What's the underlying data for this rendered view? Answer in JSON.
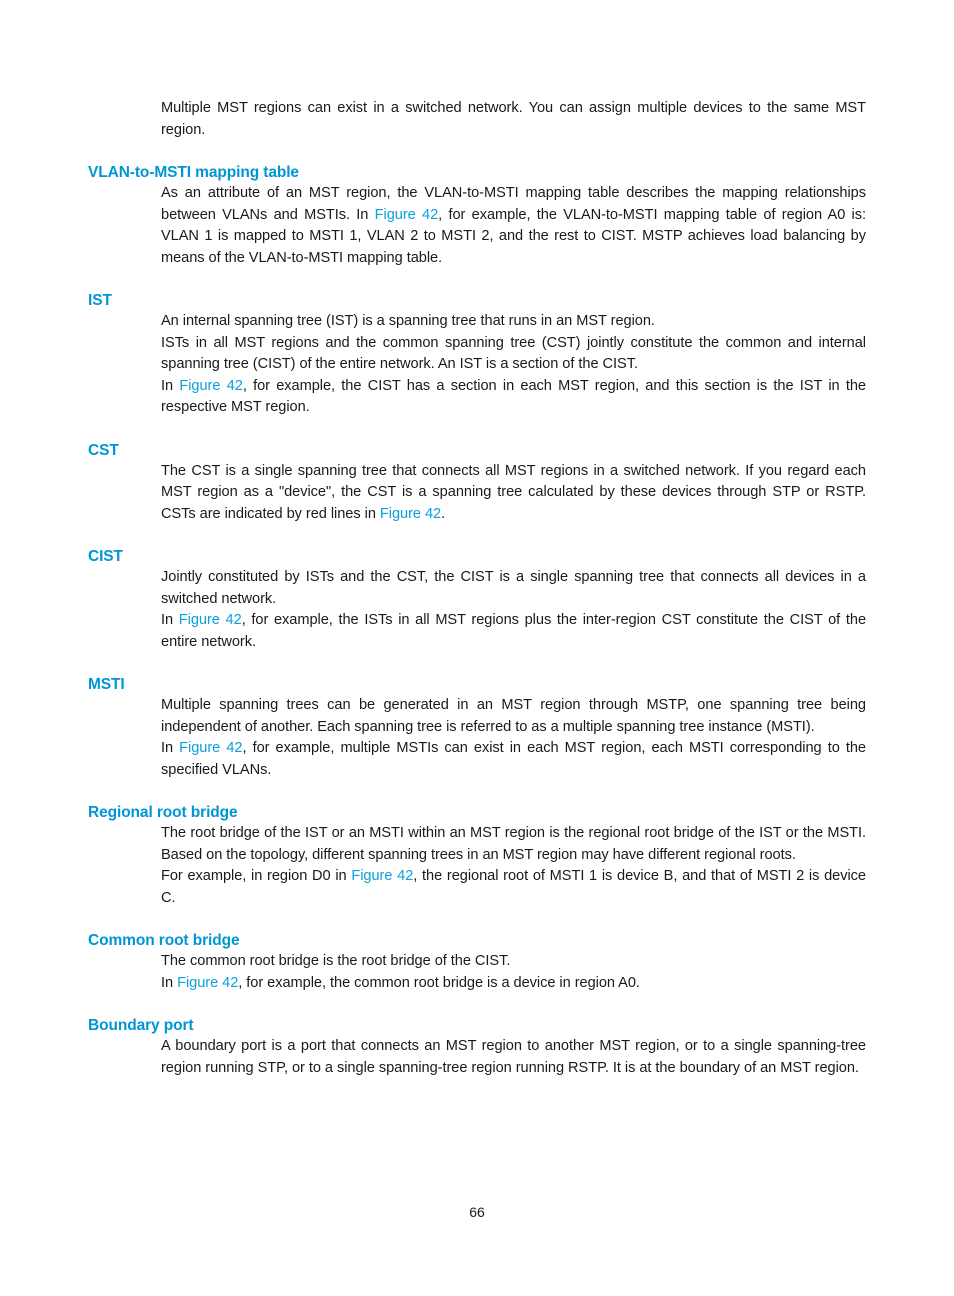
{
  "document": {
    "page_number": "66",
    "heading_color": "#0096D6",
    "link_color": "#0B9FDC",
    "body_color": "#1A1A1A",
    "background_color": "#FFFFFF"
  },
  "intro": {
    "paragraph": "Multiple MST regions can exist in a switched network. You can assign multiple devices to the same MST region."
  },
  "sections": [
    {
      "id": "vlan-to-msti-mapping-table",
      "heading": "VLAN-to-MSTI mapping table",
      "paragraphs": [
        {
          "parts": [
            {
              "type": "text",
              "value": "As an attribute of an MST region, the VLAN-to-MSTI mapping table describes the mapping relationships between VLANs and MSTIs. In "
            },
            {
              "type": "link",
              "value": "Figure 42"
            },
            {
              "type": "text",
              "value": ", for example, the VLAN-to-MSTI mapping table of region A0 is: VLAN 1 is mapped to MSTI 1, VLAN 2 to MSTI 2, and the rest to CIST. MSTP achieves load balancing by means of the VLAN-to-MSTI mapping table."
            }
          ]
        }
      ]
    },
    {
      "id": "ist",
      "heading": "IST",
      "paragraphs": [
        {
          "parts": [
            {
              "type": "text",
              "value": "An internal spanning tree (IST) is a spanning tree that runs in an MST region."
            }
          ]
        },
        {
          "parts": [
            {
              "type": "text",
              "value": "ISTs in all MST regions and the common spanning tree (CST) jointly constitute the common and internal spanning tree (CIST) of the entire network. An IST is a section of the CIST."
            }
          ]
        },
        {
          "parts": [
            {
              "type": "text",
              "value": "In "
            },
            {
              "type": "link",
              "value": "Figure 42"
            },
            {
              "type": "text",
              "value": ", for example, the CIST has a section in each MST region, and this section is the IST in the respective MST region."
            }
          ]
        }
      ]
    },
    {
      "id": "cst",
      "heading": "CST",
      "paragraphs": [
        {
          "parts": [
            {
              "type": "text",
              "value": "The CST is a single spanning tree that connects all MST regions in a switched network. If you regard each MST region as a \"device\", the CST is a spanning tree calculated by these devices through STP or RSTP. CSTs are indicated by red lines in "
            },
            {
              "type": "link",
              "value": "Figure 42"
            },
            {
              "type": "text",
              "value": "."
            }
          ]
        }
      ]
    },
    {
      "id": "cist",
      "heading": "CIST",
      "paragraphs": [
        {
          "parts": [
            {
              "type": "text",
              "value": "Jointly constituted by ISTs and the CST, the CIST is a single spanning tree that connects all devices in a switched network."
            }
          ]
        },
        {
          "parts": [
            {
              "type": "text",
              "value": "In "
            },
            {
              "type": "link",
              "value": "Figure 42"
            },
            {
              "type": "text",
              "value": ", for example, the ISTs in all MST regions plus the inter-region CST constitute the CIST of the entire network."
            }
          ]
        }
      ]
    },
    {
      "id": "msti",
      "heading": "MSTI",
      "paragraphs": [
        {
          "parts": [
            {
              "type": "text",
              "value": "Multiple spanning trees can be generated in an MST region through MSTP, one spanning tree being independent of another. Each spanning tree is referred to as a multiple spanning tree instance (MSTI)."
            }
          ]
        },
        {
          "parts": [
            {
              "type": "text",
              "value": "In "
            },
            {
              "type": "link",
              "value": "Figure 42"
            },
            {
              "type": "text",
              "value": ", for example, multiple MSTIs can exist in each MST region, each MSTI corresponding to the specified VLANs."
            }
          ]
        }
      ]
    },
    {
      "id": "regional-root-bridge",
      "heading": "Regional root bridge",
      "paragraphs": [
        {
          "parts": [
            {
              "type": "text",
              "value": "The root bridge of the IST or an MSTI within an MST region is the regional root bridge of the IST or the MSTI. Based on the topology, different spanning trees in an MST region may have different regional roots."
            }
          ]
        },
        {
          "parts": [
            {
              "type": "text",
              "value": "For example, in region D0 in "
            },
            {
              "type": "link",
              "value": "Figure 42"
            },
            {
              "type": "text",
              "value": ", the regional root of MSTI 1 is device B, and that of MSTI 2 is device C."
            }
          ]
        }
      ]
    },
    {
      "id": "common-root-bridge",
      "heading": "Common root bridge",
      "paragraphs": [
        {
          "parts": [
            {
              "type": "text",
              "value": "The common root bridge is the root bridge of the CIST."
            }
          ]
        },
        {
          "parts": [
            {
              "type": "text",
              "value": "In "
            },
            {
              "type": "link",
              "value": "Figure 42"
            },
            {
              "type": "text",
              "value": ", for example, the common root bridge is a device in region A0."
            }
          ]
        }
      ]
    },
    {
      "id": "boundary-port",
      "heading": "Boundary port",
      "paragraphs": [
        {
          "parts": [
            {
              "type": "text",
              "value": "A boundary port is a port that connects an MST region to another MST region, or to a single spanning-tree region running STP, or to a single spanning-tree region running RSTP. It is at the boundary of an MST region."
            }
          ]
        }
      ]
    }
  ]
}
